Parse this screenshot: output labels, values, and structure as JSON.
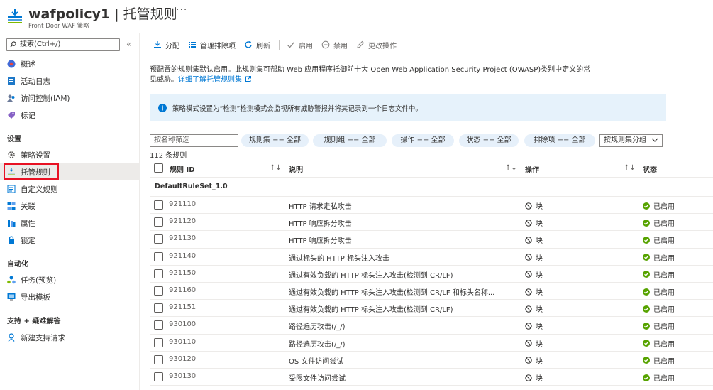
{
  "header": {
    "title_name": "wafpolicy1",
    "title_sep": " | ",
    "title_section": "托管规则",
    "more": "···",
    "subtitle": "Front Door WAF 策略"
  },
  "sidebar": {
    "search_placeholder": "搜索(Ctrl+/)",
    "collapse": "«",
    "items_top": [
      {
        "label": "概述",
        "icon": "overview-icon"
      },
      {
        "label": "活动日志",
        "icon": "activity-log-icon"
      },
      {
        "label": "访问控制(IAM)",
        "icon": "iam-icon"
      },
      {
        "label": "标记",
        "icon": "tag-icon"
      }
    ],
    "section_settings": "设置",
    "items_settings": [
      {
        "label": "策略设置",
        "icon": "gear-icon"
      },
      {
        "label": "托管规则",
        "icon": "managed-rules-icon",
        "active": true
      },
      {
        "label": "自定义规则",
        "icon": "custom-rules-icon"
      },
      {
        "label": "关联",
        "icon": "association-icon"
      },
      {
        "label": "属性",
        "icon": "properties-icon"
      },
      {
        "label": "锁定",
        "icon": "lock-icon"
      }
    ],
    "section_automation": "自动化",
    "items_automation": [
      {
        "label": "任务(预览)",
        "icon": "tasks-icon"
      },
      {
        "label": "导出模板",
        "icon": "export-template-icon"
      }
    ],
    "section_support": "支持 + 疑难解答",
    "items_support": [
      {
        "label": "新建支持请求",
        "icon": "support-icon"
      }
    ]
  },
  "toolbar": {
    "assign": "分配",
    "manage_exclusions": "管理排除项",
    "refresh": "刷新",
    "enable": "启用",
    "disable": "禁用",
    "change_action": "更改操作"
  },
  "description": {
    "line1": "预配置的规则集默认启用。此规则集可帮助 Web 应用程序抵御前十大 Open Web Application Security Project (OWASP)类别中定义的常",
    "line2": "见威胁。",
    "link": "详细了解托管规则集"
  },
  "info_banner": "策略模式设置为“检测”检测模式会监视所有威胁警报并将其记录到一个日志文件中。",
  "filters": {
    "name_placeholder": "按名称筛选",
    "ruleset": "规则集 == 全部",
    "rulegroup": "规则组 == 全部",
    "action": "操作 == 全部",
    "status": "状态 == 全部",
    "exclusions": "排除项 == 全部",
    "group_by": "按规则集分组"
  },
  "count": "112 条规则",
  "table": {
    "col_id": "规则 ID",
    "col_desc": "说明",
    "col_action": "操作",
    "col_status": "状态",
    "sort_glyph": "↑↓",
    "group": "DefaultRuleSet_1.0",
    "rows": [
      {
        "id": "921110",
        "desc": "HTTP 请求走私攻击",
        "action": "块",
        "status": "已启用"
      },
      {
        "id": "921120",
        "desc": "HTTP 响应拆分攻击",
        "action": "块",
        "status": "已启用"
      },
      {
        "id": "921130",
        "desc": "HTTP 响应拆分攻击",
        "action": "块",
        "status": "已启用"
      },
      {
        "id": "921140",
        "desc": "通过标头的 HTTP 标头注入攻击",
        "action": "块",
        "status": "已启用"
      },
      {
        "id": "921150",
        "desc": "通过有效负载的 HTTP 标头注入攻击(检测到 CR/LF)",
        "action": "块",
        "status": "已启用"
      },
      {
        "id": "921160",
        "desc": "通过有效负载的 HTTP 标头注入攻击(检测到 CR/LF 和标头名称...",
        "action": "块",
        "status": "已启用"
      },
      {
        "id": "921151",
        "desc": "通过有效负载的 HTTP 标头注入攻击(检测到 CR/LF)",
        "action": "块",
        "status": "已启用"
      },
      {
        "id": "930100",
        "desc": "路径遍历攻击(/_/)",
        "action": "块",
        "status": "已启用"
      },
      {
        "id": "930110",
        "desc": "路径遍历攻击(/_/)",
        "action": "块",
        "status": "已启用"
      },
      {
        "id": "930120",
        "desc": "OS 文件访问尝试",
        "action": "块",
        "status": "已启用"
      },
      {
        "id": "930130",
        "desc": "受限文件访问尝试",
        "action": "块",
        "status": "已启用"
      }
    ]
  },
  "colors": {
    "accent": "#0078d4",
    "success": "#57a300",
    "highlight_border": "#e81123",
    "info_bg": "#e6f2fb",
    "pill_bg": "#e6f0fa"
  }
}
